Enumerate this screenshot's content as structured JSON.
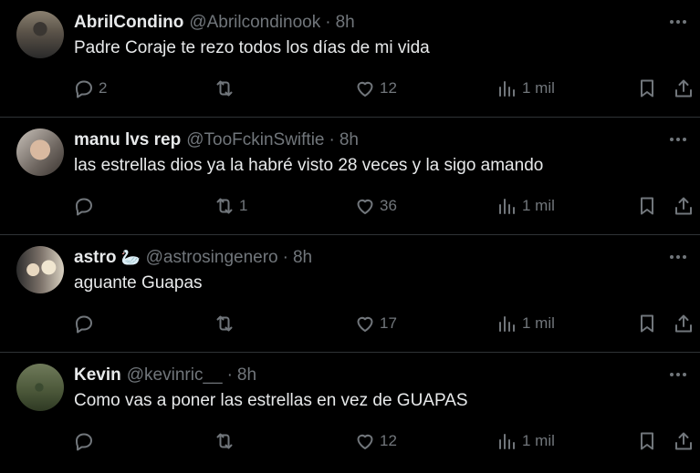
{
  "tweets": [
    {
      "display_name": "AbrilCondino",
      "handle": "@Abrilcondinook",
      "separator": "·",
      "time": "8h",
      "text": "Padre Coraje te rezo todos los días de mi vida",
      "replies": "2",
      "retweets": "",
      "likes": "12",
      "views": "1 mil"
    },
    {
      "display_name": "manu lvs rep",
      "handle": "@TooFckinSwiftie",
      "separator": "·",
      "time": "8h",
      "text": "las estrellas dios ya la habré visto 28 veces y  la sigo amando",
      "replies": "",
      "retweets": "1",
      "likes": "36",
      "views": "1 mil"
    },
    {
      "display_name": "astro",
      "name_emoji": "🦢",
      "handle": "@astrosingenero",
      "separator": "·",
      "time": "8h",
      "text": "aguante Guapas",
      "replies": "",
      "retweets": "",
      "likes": "17",
      "views": "1 mil"
    },
    {
      "display_name": "Kevin",
      "handle": "@kevinric__",
      "separator": "·",
      "time": "8h",
      "text": "Como vas a poner las estrellas en vez de GUAPAS",
      "replies": "",
      "retweets": "",
      "likes": "12",
      "views": "1 mil"
    }
  ],
  "icons": {
    "reply": "reply-icon",
    "retweet": "retweet-icon",
    "like": "heart-icon",
    "views": "views-icon",
    "bookmark": "bookmark-icon",
    "share": "share-icon",
    "more": "more-icon"
  },
  "colors": {
    "background": "#000000",
    "text": "#e7e9ea",
    "muted": "#71767b",
    "divider": "#2f3336"
  }
}
